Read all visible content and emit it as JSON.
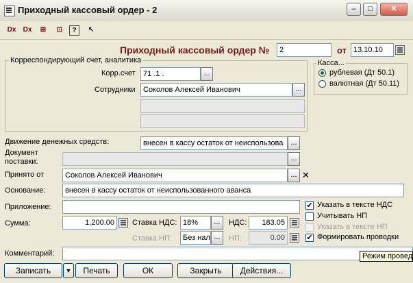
{
  "window": {
    "title": "Приходный кассовый ордер - 2",
    "minimize": "–",
    "maximize": "□",
    "close": "✕"
  },
  "toolbar": {
    "b1": "Dx",
    "b2": "Dx",
    "b3": "⊞",
    "b4": "⊡",
    "b5": "?",
    "b6": "↖"
  },
  "doc": {
    "title": "Приходный кассовый ордер №",
    "number": "2",
    "date_label": "от",
    "date": "13.10.10"
  },
  "correspond": {
    "group_label": "Корреспондирующий счет, аналитика",
    "account_label": "Корр.счет",
    "account": "71 .1 .",
    "employees_label": "Сотрудники",
    "employee": "Соколов Алексей Иванович"
  },
  "cash": {
    "group_label": "Касса...",
    "ruble": "рублевая (Дт 50.1)",
    "currency": "валютная (Дт 50.11)"
  },
  "movement": {
    "label": "Движение денежных средств:",
    "value": "внесен в кассу остаток от неиспользова"
  },
  "delivery": {
    "label1": "Документ",
    "label2": "поставки:",
    "value": ""
  },
  "received": {
    "label": "Принято от",
    "value": "Соколов Алексей Иванович",
    "clear": "✕"
  },
  "basis": {
    "label": "Основание:",
    "value": "внесен в кассу остаток от неиспользованного аванса"
  },
  "attachment": {
    "label": "Приложение:",
    "value": ""
  },
  "sum": {
    "label": "Сумма:",
    "value": "1,200.00"
  },
  "vat": {
    "rate_label": "Ставка НДС:",
    "rate": "18%",
    "label": "НДС:",
    "value": "183.05"
  },
  "np": {
    "rate_label": "Ставка НП:",
    "rate": "Без нал",
    "label": "НП:",
    "value": "0.00"
  },
  "checks": {
    "vat_text": "Указать в тексте НДС",
    "count_np": "Учитывать НП",
    "np_text": "Указать в тексте НП",
    "entries": "Формировать проводки"
  },
  "comment": {
    "label": "Комментарий:",
    "value": ""
  },
  "tooltip": "Режим проведе",
  "buttons": {
    "save": "Записать",
    "arrow": "▼",
    "print": "Печать",
    "ok": "ОК",
    "close": "Закрыть",
    "actions": "Действия..."
  },
  "ellipsis": "..."
}
